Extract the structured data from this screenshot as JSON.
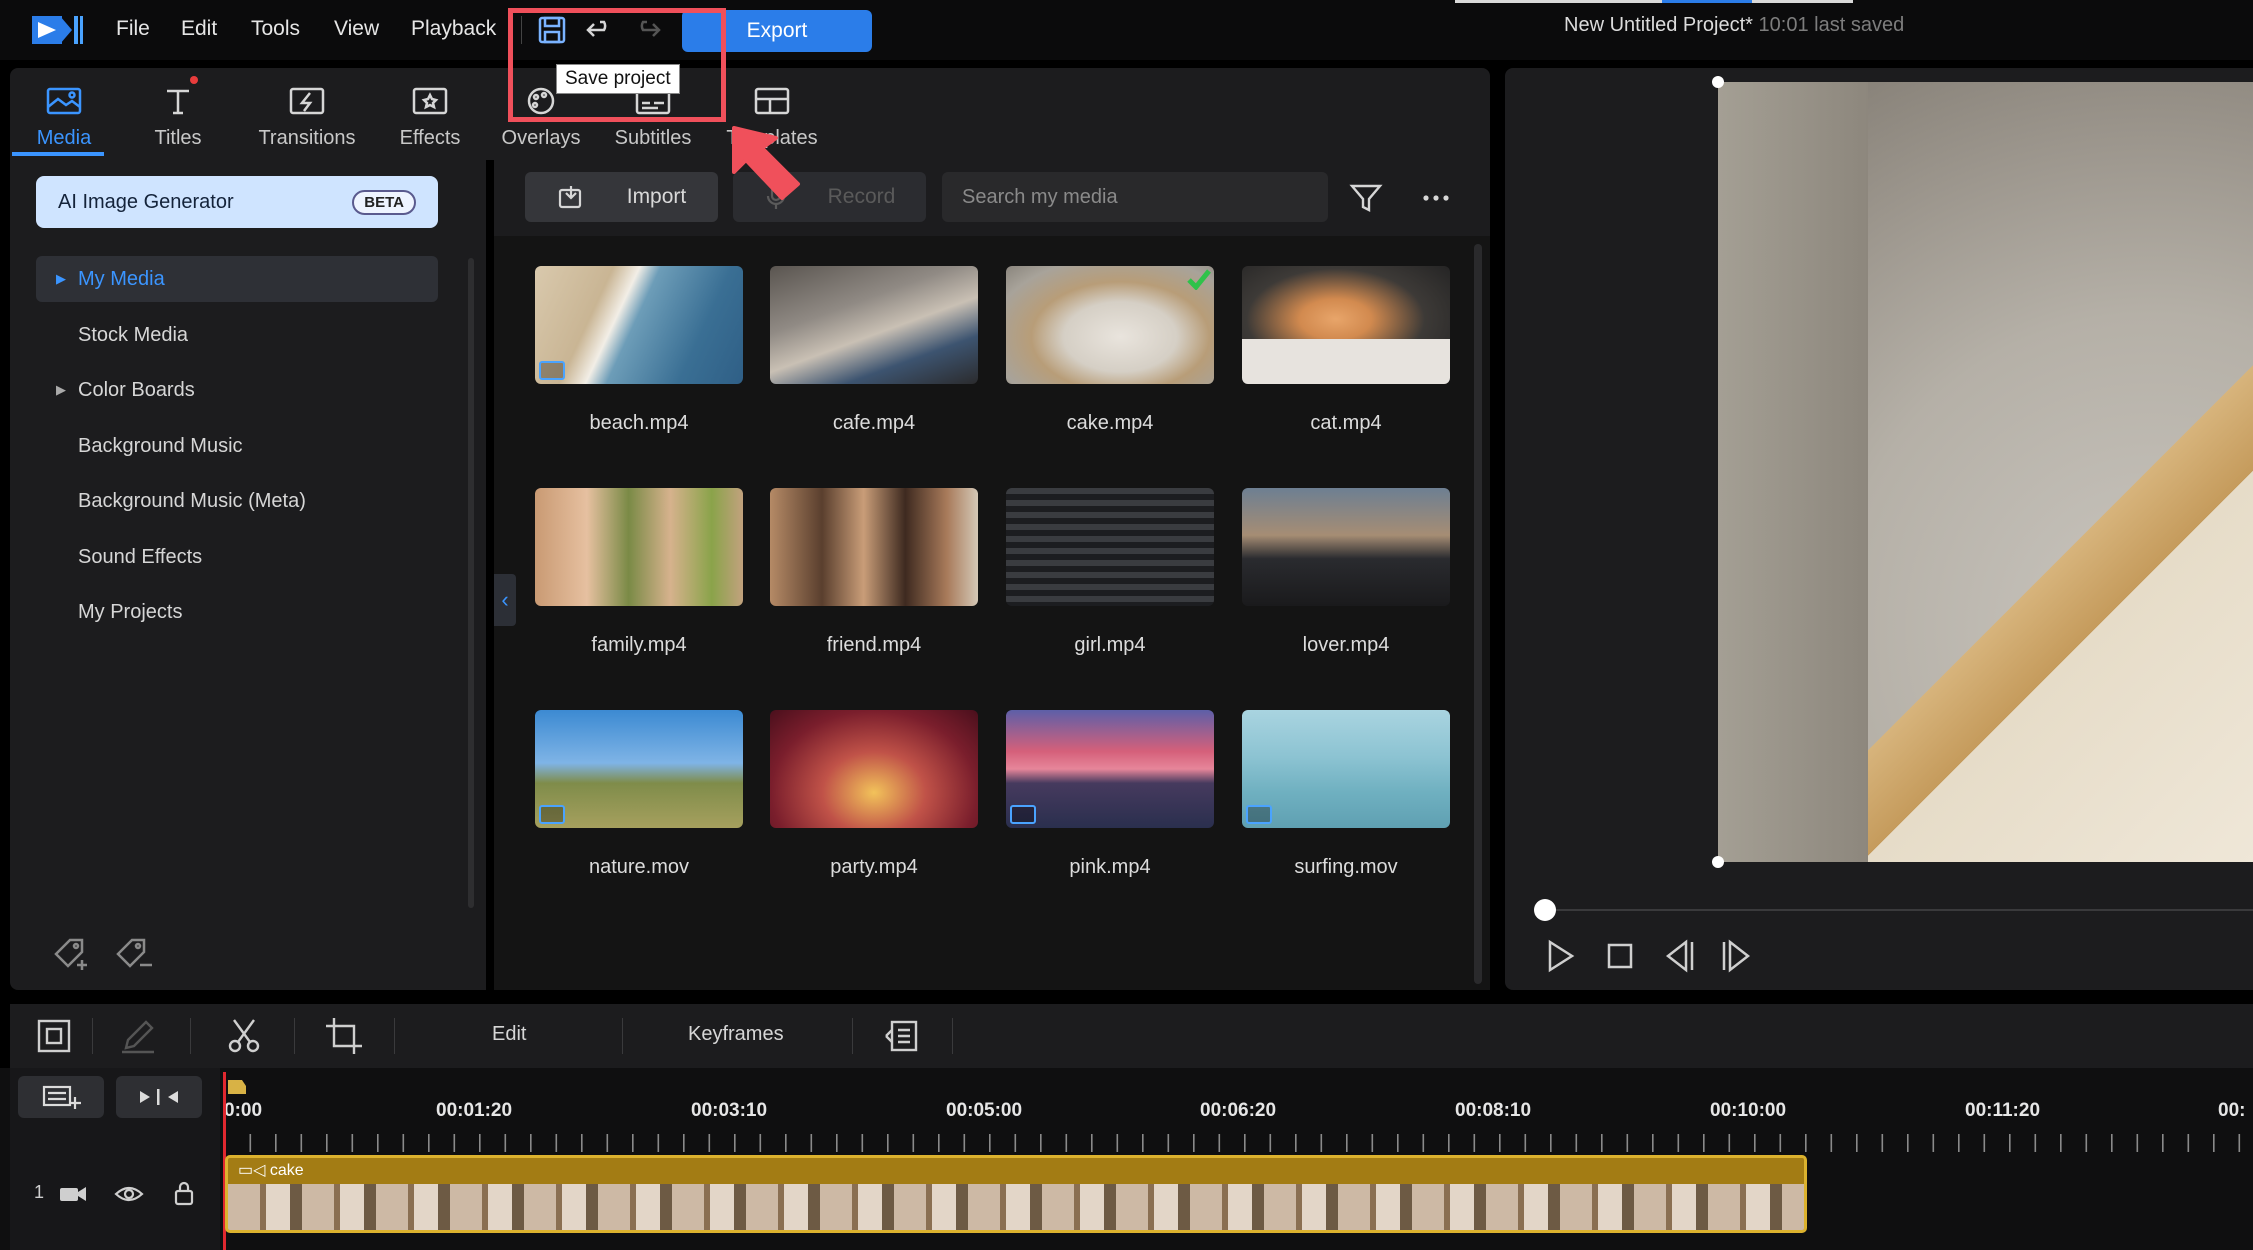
{
  "menubar": {
    "items": [
      "File",
      "Edit",
      "Tools",
      "View",
      "Playback"
    ],
    "export_label": "Export",
    "project_title": "New Untitled Project*",
    "last_saved": "10:01 last saved"
  },
  "tooltip": "Save project",
  "tabs": [
    {
      "label": "Media",
      "icon": "media-icon",
      "active": true
    },
    {
      "label": "Titles",
      "icon": "titles-icon"
    },
    {
      "label": "Transitions",
      "icon": "transitions-icon"
    },
    {
      "label": "Effects",
      "icon": "effects-icon"
    },
    {
      "label": "Overlays",
      "icon": "overlays-icon"
    },
    {
      "label": "Subtitles",
      "icon": "subtitles-icon"
    },
    {
      "label": "Templates",
      "icon": "templates-icon"
    }
  ],
  "sidebar": {
    "ai_button": "AI Image Generator",
    "beta_badge": "BETA",
    "items": [
      "My Media",
      "Stock Media",
      "Color Boards",
      "Background Music",
      "Background Music (Meta)",
      "Sound Effects",
      "My Projects"
    ]
  },
  "media_toolbar": {
    "import_label": "Import",
    "record_label": "Record",
    "search_placeholder": "Search my media"
  },
  "media": [
    {
      "name": "beach.mp4"
    },
    {
      "name": "cafe.mp4"
    },
    {
      "name": "cake.mp4"
    },
    {
      "name": "cat.mp4"
    },
    {
      "name": "family.mp4"
    },
    {
      "name": "friend.mp4"
    },
    {
      "name": "girl.mp4"
    },
    {
      "name": "lover.mp4"
    },
    {
      "name": "nature.mov"
    },
    {
      "name": "party.mp4"
    },
    {
      "name": "pink.mp4"
    },
    {
      "name": "surfing.mov"
    }
  ],
  "timeline": {
    "edit_label": "Edit",
    "keyframes_label": "Keyframes",
    "ruler": [
      "0:00",
      "00:01:20",
      "00:03:10",
      "00:05:00",
      "00:06:20",
      "00:08:10",
      "00:10:00",
      "00:11:20",
      "00:"
    ],
    "track_number": "1",
    "clip_name": "cake"
  },
  "colors": {
    "accent": "#3b95ff",
    "export": "#2b7de9",
    "clip": "#a37c14",
    "highlight": "#f0505b"
  }
}
